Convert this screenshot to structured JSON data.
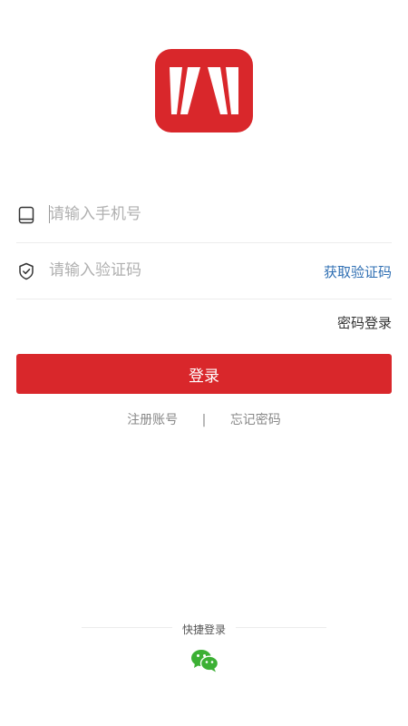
{
  "form": {
    "phone_placeholder": "请输入手机号",
    "code_placeholder": "请输入验证码",
    "get_code_label": "获取验证码",
    "password_login_label": "密码登录",
    "login_button_label": "登录"
  },
  "links": {
    "register_label": "注册账号",
    "separator": "|",
    "forgot_label": "忘记密码"
  },
  "quick_login": {
    "label": "快捷登录",
    "wechat_icon": "wechat-icon"
  },
  "colors": {
    "brand_red": "#d9272b",
    "link_blue": "#2f6fb3",
    "wechat_green": "#3cb034"
  }
}
